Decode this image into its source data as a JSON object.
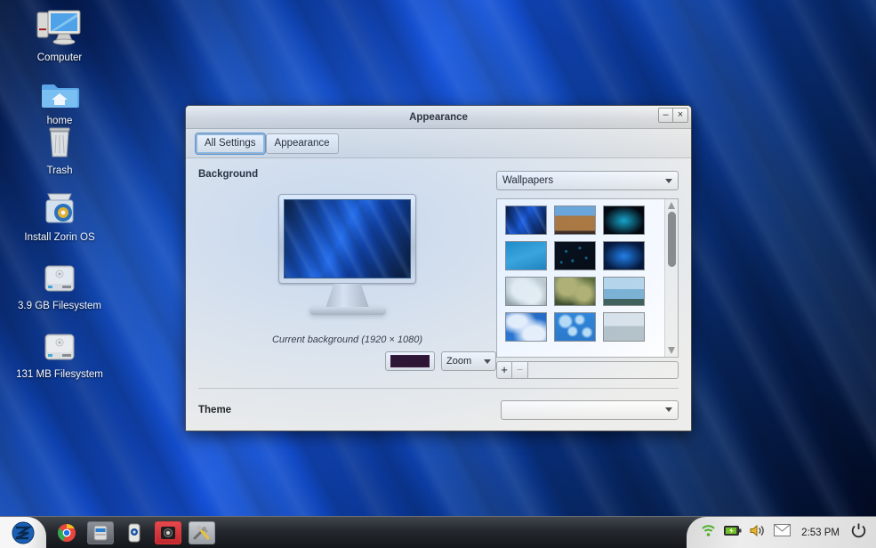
{
  "desktop": {
    "icons": [
      {
        "label": "Computer",
        "icon": "computer-icon"
      },
      {
        "label": "home",
        "icon": "home-folder-icon"
      },
      {
        "label": "Trash",
        "icon": "trash-icon"
      },
      {
        "label": "Install Zorin OS",
        "icon": "installer-disc-icon"
      },
      {
        "label": "3.9 GB Filesystem",
        "icon": "drive-harddisk-icon"
      },
      {
        "label": "131 MB Filesystem",
        "icon": "drive-harddisk-icon"
      }
    ]
  },
  "window": {
    "title": "Appearance",
    "minimize_label": "–",
    "close_label": "×",
    "toolbar": {
      "all_settings_label": "All Settings",
      "appearance_label": "Appearance"
    },
    "background": {
      "heading": "Background",
      "current_label": "Current background  (1920 × 1080)",
      "swatch_color": "#2c0a22",
      "zoom_label": "Zoom",
      "source_label": "Wallpapers",
      "add_label": "+",
      "remove_label": "−",
      "add_field_value": "",
      "thumbnails": [
        {
          "name": "blue-streaks",
          "c1": "#041033",
          "c2": "#1553d6",
          "c3": "#020a20",
          "kind": "streaks"
        },
        {
          "name": "colosseum",
          "c1": "#6fa8d8",
          "c2": "#b5762f",
          "c3": "#3d2412",
          "kind": "ruins"
        },
        {
          "name": "teal-glow",
          "c1": "#000000",
          "c2": "#14a6c8",
          "c3": "#000000",
          "kind": "radial"
        },
        {
          "name": "cyan-flat",
          "c1": "#1b8cc4",
          "c2": "#3aa8d8",
          "c3": "#1b82ba",
          "kind": "flat"
        },
        {
          "name": "night-sparks",
          "c1": "#020406",
          "c2": "#0d5f78",
          "c3": "#010203",
          "kind": "sparks"
        },
        {
          "name": "blue-radial",
          "c1": "#021233",
          "c2": "#1f7fe8",
          "c3": "#020a20",
          "kind": "radial"
        },
        {
          "name": "white-blossom",
          "c1": "#cfd4d0",
          "c2": "#f4f6f2",
          "c3": "#9aa49a",
          "kind": "blossom"
        },
        {
          "name": "autumn-tree",
          "c1": "#5e6b2a",
          "c2": "#b9b46a",
          "c3": "#3f4a1e",
          "kind": "tree"
        },
        {
          "name": "coast-cliffs",
          "c1": "#bcd9ea",
          "c2": "#7fb4d2",
          "c3": "#3f5f54",
          "kind": "coast"
        },
        {
          "name": "clouds-sky",
          "c1": "#1e68c0",
          "c2": "#f2f6fb",
          "c3": "#2a76d0",
          "kind": "clouds"
        },
        {
          "name": "blue-bokeh",
          "c1": "#2f86d8",
          "c2": "#bfe0f5",
          "c3": "#2a78c8",
          "kind": "bokeh"
        },
        {
          "name": "winter-bridge",
          "c1": "#dfe6ea",
          "c2": "#8d7a62",
          "c3": "#b9c4c8",
          "kind": "bridge"
        }
      ]
    },
    "theme": {
      "heading": "Theme",
      "selected": ""
    }
  },
  "taskbar": {
    "start_label": "Z",
    "items": [
      {
        "name": "chrome-icon",
        "style": "plain"
      },
      {
        "name": "file-manager-icon",
        "style": "boxed"
      },
      {
        "name": "device-icon",
        "style": "plain"
      },
      {
        "name": "camera-app-icon",
        "style": "redbox"
      },
      {
        "name": "tools-icon",
        "style": "graybox"
      }
    ],
    "tray": [
      {
        "name": "wifi-icon"
      },
      {
        "name": "battery-icon"
      },
      {
        "name": "volume-icon"
      },
      {
        "name": "mail-icon"
      }
    ],
    "clock": "2:53 PM",
    "power_label": "⏻"
  }
}
